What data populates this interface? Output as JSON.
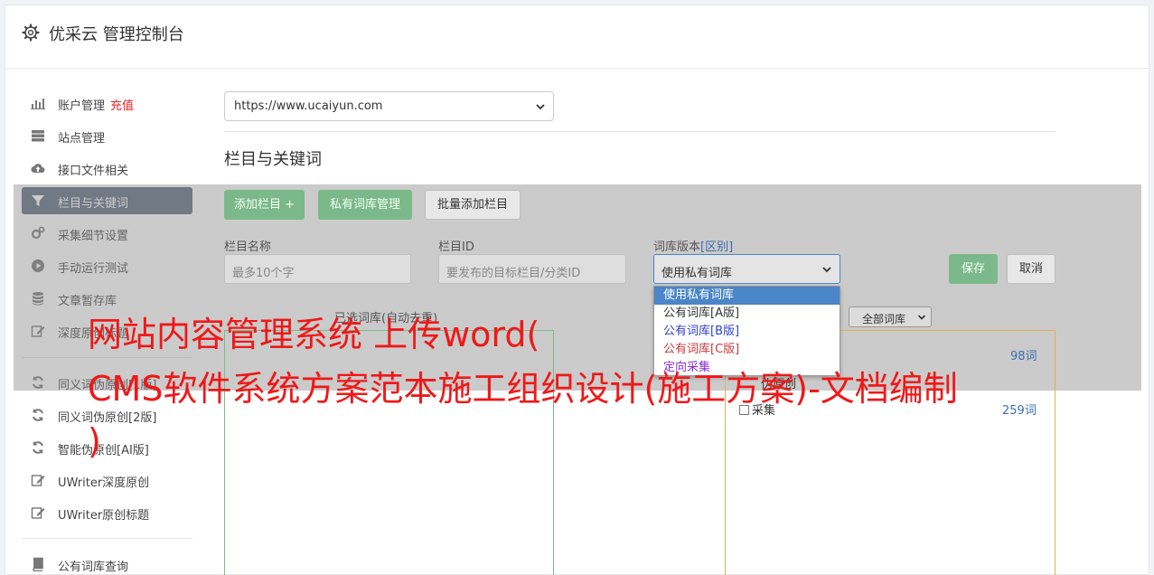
{
  "header": {
    "title": "优采云 管理控制台"
  },
  "sidebar": {
    "items": [
      {
        "label": "账户管理",
        "badge": "充值"
      },
      {
        "label": "站点管理"
      },
      {
        "label": "接口文件相关"
      },
      {
        "label": "栏目与关键词"
      },
      {
        "label": "采集细节设置"
      },
      {
        "label": "手动运行测试"
      },
      {
        "label": "文章暂存库"
      },
      {
        "label": "深度原创标题"
      },
      {
        "label": "同义词伪原创[1版]"
      },
      {
        "label": "同义词伪原创[2版]"
      },
      {
        "label": "智能伪原创[AI版]"
      },
      {
        "label": "UWriter深度原创"
      },
      {
        "label": "UWriter原创标题"
      },
      {
        "label": "公有词库查询"
      }
    ]
  },
  "main": {
    "site_select": "https://www.ucaiyun.com",
    "section_title": "栏目与关键词",
    "buttons": {
      "add_column": "添加栏目 +",
      "private_lib": "私有词库管理",
      "batch_add": "批量添加栏目",
      "save": "保存",
      "cancel": "取消"
    },
    "form": {
      "name_label": "栏目名称",
      "name_placeholder": "最多10个字",
      "id_label": "栏目ID",
      "id_placeholder": "要发布的目标栏目/分类ID",
      "version_label": "词库版本",
      "version_label_accent": "[区别]",
      "version_value": "使用私有词库"
    },
    "dropdown_options": [
      "使用私有词库",
      "公有词库[A版]",
      "公有词库[B版]",
      "公有词库[C版]",
      "定向采集"
    ],
    "dropdown_colors": [
      "#ffffff",
      "#333333",
      "#2d3fd1",
      "#c83a3a",
      "#8a2be2"
    ],
    "selected_label": "已选词库(自动去重)",
    "filter_select": "全部词库",
    "right_panel": {
      "partial_label": "伪原创",
      "rows": [
        {
          "label": "",
          "count": "98词"
        },
        {
          "label": "",
          "count": ""
        },
        {
          "label": "采集",
          "count": "259词"
        }
      ]
    }
  },
  "watermark": {
    "line1": "网站内容管理系统 上传word(",
    "line2": "CMS软件系统方案范本施工组织设计(施工方案)-文档编制",
    "line3": ")"
  }
}
